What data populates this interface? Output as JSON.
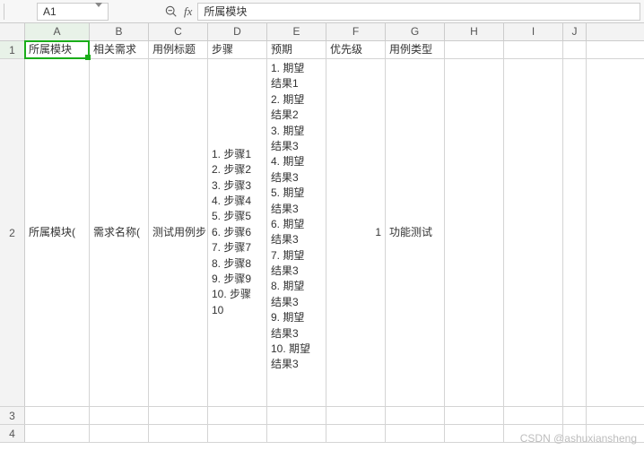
{
  "toolbar": {
    "name_box": "A1",
    "formula_value": "所属模块"
  },
  "columns": [
    "A",
    "B",
    "C",
    "D",
    "E",
    "F",
    "G",
    "H",
    "I",
    "J"
  ],
  "rows": [
    "1",
    "2",
    "3",
    "4"
  ],
  "header": {
    "A": "所属模块",
    "B": "相关需求",
    "C": "用例标题",
    "D": "步骤",
    "E": "预期",
    "F": "优先级",
    "G": "用例类型"
  },
  "row2": {
    "A": "所属模块(",
    "B": "需求名称(",
    "C": "测试用例步",
    "D": "1. 步骤1\n2. 步骤2\n3. 步骤3\n4. 步骤4\n5. 步骤5\n6. 步骤6\n7. 步骤7\n8. 步骤8\n9. 步骤9\n10. 步骤\n10",
    "E": "1. 期望\n结果1\n2. 期望\n结果2\n3. 期望\n结果3\n4. 期望\n结果3\n5. 期望\n结果3\n6. 期望\n结果3\n7. 期望\n结果3\n8. 期望\n结果3\n9. 期望\n结果3\n10. 期望\n结果3",
    "F": "1",
    "G": "功能测试"
  },
  "watermark": "CSDN @ashuxiansheng"
}
